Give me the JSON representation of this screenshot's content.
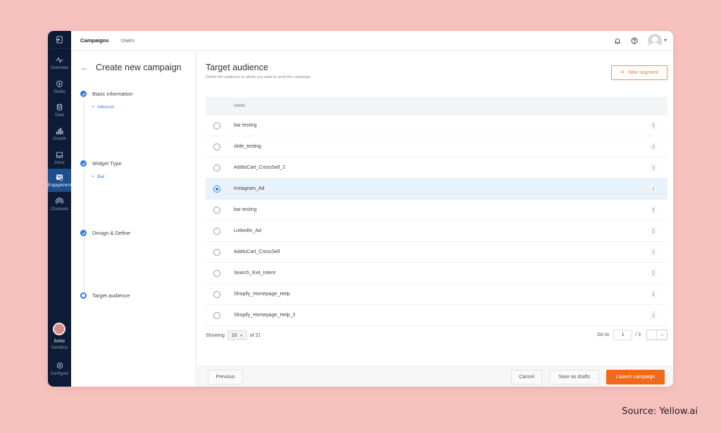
{
  "rail": {
    "items": [
      {
        "label": "Overview",
        "icon": "activity-icon"
      },
      {
        "label": "Studio",
        "icon": "shield-icon"
      },
      {
        "label": "Data",
        "icon": "database-icon"
      },
      {
        "label": "Growth",
        "icon": "bar-chart-icon"
      },
      {
        "label": "Inbox",
        "icon": "inbox-icon"
      },
      {
        "label": "Engagement",
        "icon": "engagement-icon",
        "active": true
      },
      {
        "label": "Channels",
        "icon": "broadcast-icon"
      }
    ],
    "bot_name": "Bottie",
    "bot_env": "Sandbox",
    "configure": "Configure"
  },
  "topbar": {
    "tabs": [
      "Campaigns",
      "Users"
    ],
    "active_tab": "Campaigns"
  },
  "steps_panel": {
    "title": "Create new campaign",
    "steps": [
      {
        "label": "Basic information",
        "sub": "Inbound",
        "state": "done"
      },
      {
        "label": "Widget Type",
        "sub": "Bar",
        "state": "done"
      },
      {
        "label": "Design & Define",
        "sub": "",
        "state": "done"
      },
      {
        "label": "Target audience",
        "sub": "",
        "state": "current"
      }
    ]
  },
  "main": {
    "title": "Target audience",
    "subtitle": "Define the audience to whom you want to send the campaign.",
    "new_segment": "New segment",
    "column_name": "NAME",
    "rows": [
      {
        "name": "bar testing",
        "selected": false
      },
      {
        "name": "slide_testing",
        "selected": false
      },
      {
        "name": "AddtoCart_CrossSell_2",
        "selected": false
      },
      {
        "name": "Instagram_Ad",
        "selected": true
      },
      {
        "name": "bar testing",
        "selected": false
      },
      {
        "name": "LinkedIn_Ad",
        "selected": false
      },
      {
        "name": "AddtoCart_CrossSell",
        "selected": false
      },
      {
        "name": "Search_Exit_Intent",
        "selected": false
      },
      {
        "name": "Shopify_Homepage_Help",
        "selected": false
      },
      {
        "name": "Shopify_Homepage_Help_2",
        "selected": false
      }
    ],
    "pagination": {
      "showing_label": "Showing",
      "page_size": "10",
      "of_label": "of 21",
      "goto_label": "Go to",
      "current_page": "1",
      "total_pages": "/ 3"
    }
  },
  "footer": {
    "previous": "Previous",
    "cancel": "Cancel",
    "save_drafts": "Save as drafts",
    "launch": "Launch campaign"
  },
  "source": "Source: Yellow.ai",
  "colors": {
    "accent_blue": "#2f7be0",
    "accent_orange": "#f06a19",
    "rail_bg": "#0d1b35",
    "page_bg": "#f7c1be"
  }
}
